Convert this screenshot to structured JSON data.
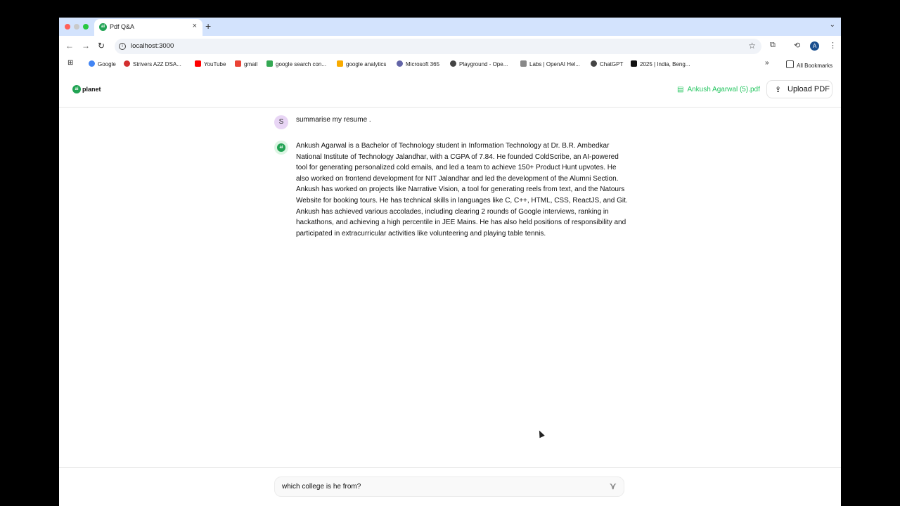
{
  "browser": {
    "tab_title": "Pdf Q&A",
    "tab_close": "×",
    "new_tab": "+",
    "tabs_menu": "⌄",
    "url": "localhost:3000",
    "accent": "#d3e3fd",
    "avatar_initial": "A",
    "bookmarks": [
      {
        "label": "Google",
        "icon": "google-icon",
        "color": "#4285f4"
      },
      {
        "label": "Strivers A2Z DSA...",
        "icon": "strivers-icon",
        "color": "#d32f2f"
      },
      {
        "label": "YouTube",
        "icon": "youtube-icon",
        "color": "#ff0000"
      },
      {
        "label": "gmail",
        "icon": "gmail-icon",
        "color": "#ea4335"
      },
      {
        "label": "google search con...",
        "icon": "search-console-icon",
        "color": "#34a853"
      },
      {
        "label": "google analytics",
        "icon": "analytics-icon",
        "color": "#f9ab00"
      },
      {
        "label": "Microsoft 365",
        "icon": "microsoft-icon",
        "color": "#6264a7"
      },
      {
        "label": "Playground - Ope...",
        "icon": "openai-icon",
        "color": "#444444"
      },
      {
        "label": "Labs | OpenAI Hel...",
        "icon": "labs-icon",
        "color": "#888888"
      },
      {
        "label": "ChatGPT",
        "icon": "chatgpt-icon",
        "color": "#444444"
      },
      {
        "label": "2025 | India, Beng...",
        "icon": "gs-icon",
        "color": "#111111"
      }
    ],
    "all_bookmarks": "All Bookmarks"
  },
  "app": {
    "logo_text": "planet",
    "logo_badge": "ai",
    "file_name": "Ankush Agarwal (5).pdf",
    "upload_label": "Upload PDF",
    "brand_color": "#21a353"
  },
  "chat": {
    "user_initial": "S",
    "user_message": "summarise my resume .",
    "ai_badge": "ai",
    "ai_message": "Ankush Agarwal is a Bachelor of Technology student in Information Technology at Dr. B.R. Ambedkar National Institute of Technology Jalandhar, with a CGPA of 7.84. He founded ColdScribe, an AI-powered tool for generating personalized cold emails, and led a team to achieve 150+ Product Hunt upvotes. He also worked on frontend development for NIT Jalandhar and led the development of the Alumni Section. Ankush has worked on projects like Narrative Vision, a tool for generating reels from text, and the Natours Website for booking tours. He has technical skills in languages like C, C++, HTML, CSS, ReactJS, and Git. Ankush has achieved various accolades, including clearing 2 rounds of Google interviews, ranking in hackathons, and achieving a high percentile in JEE Mains. He has also held positions of responsibility and participated in extracurricular activities like volunteering and playing table tennis.",
    "input_value": "which college is he from?"
  }
}
